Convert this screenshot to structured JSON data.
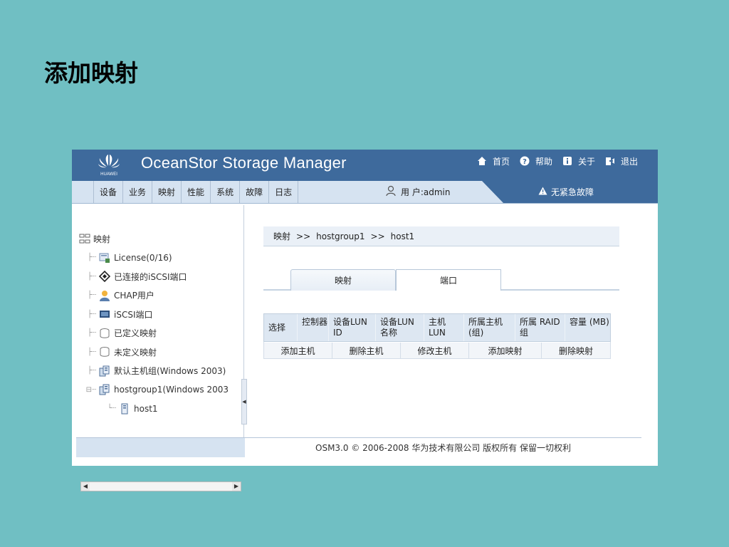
{
  "slide": {
    "title": "添加映射"
  },
  "app": {
    "title": "OceanStor Storage Manager",
    "logo_text": "HUAWEI"
  },
  "toplinks": [
    {
      "icon": "home-icon",
      "label": "首页"
    },
    {
      "icon": "help-icon",
      "label": "帮助"
    },
    {
      "icon": "info-icon",
      "label": "关于"
    },
    {
      "icon": "exit-icon",
      "label": "退出"
    }
  ],
  "menus": [
    "设备",
    "业务",
    "映射",
    "性能",
    "系统",
    "故障",
    "日志"
  ],
  "user": {
    "label": "用 户:admin"
  },
  "alarm": {
    "label": "无紧急故障"
  },
  "tree": {
    "root": "映射",
    "items": [
      {
        "icon": "license-icon",
        "label": "License(0/16)"
      },
      {
        "icon": "connected-port-icon",
        "label": "已连接的iSCSI端口"
      },
      {
        "icon": "chap-user-icon",
        "label": "CHAP用户"
      },
      {
        "icon": "iscsi-port-icon",
        "label": "iSCSI端口"
      },
      {
        "icon": "defined-mapping-icon",
        "label": "已定义映射"
      },
      {
        "icon": "undefined-mapping-icon",
        "label": "未定义映射"
      },
      {
        "icon": "host-group-icon",
        "label": "默认主机组(Windows 2003)"
      },
      {
        "icon": "host-group-icon",
        "label": "hostgroup1(Windows 2003"
      }
    ],
    "child": "host1"
  },
  "breadcrumb": [
    "映射",
    ">>",
    "hostgroup1",
    ">>",
    "host1"
  ],
  "tabs": {
    "active": "映射",
    "inactive": "端口"
  },
  "grid": {
    "headers": [
      "选择",
      "控制器",
      "设备LUN ID",
      "设备LUN 名称",
      "主机 LUN",
      "所属主机 (组)",
      "所属 RAID组",
      "容量 (MB)"
    ],
    "actions": [
      "添加主机",
      "删除主机",
      "修改主机",
      "添加映射",
      "删除映射"
    ]
  },
  "footer": {
    "copyright": "OSM3.0 © 2006-2008 华为技术有限公司 版权所有 保留一切权利"
  },
  "colors": {
    "background": "#70bfc3",
    "topbar": "#3e6a9c",
    "menubar": "#d6e3f1"
  }
}
